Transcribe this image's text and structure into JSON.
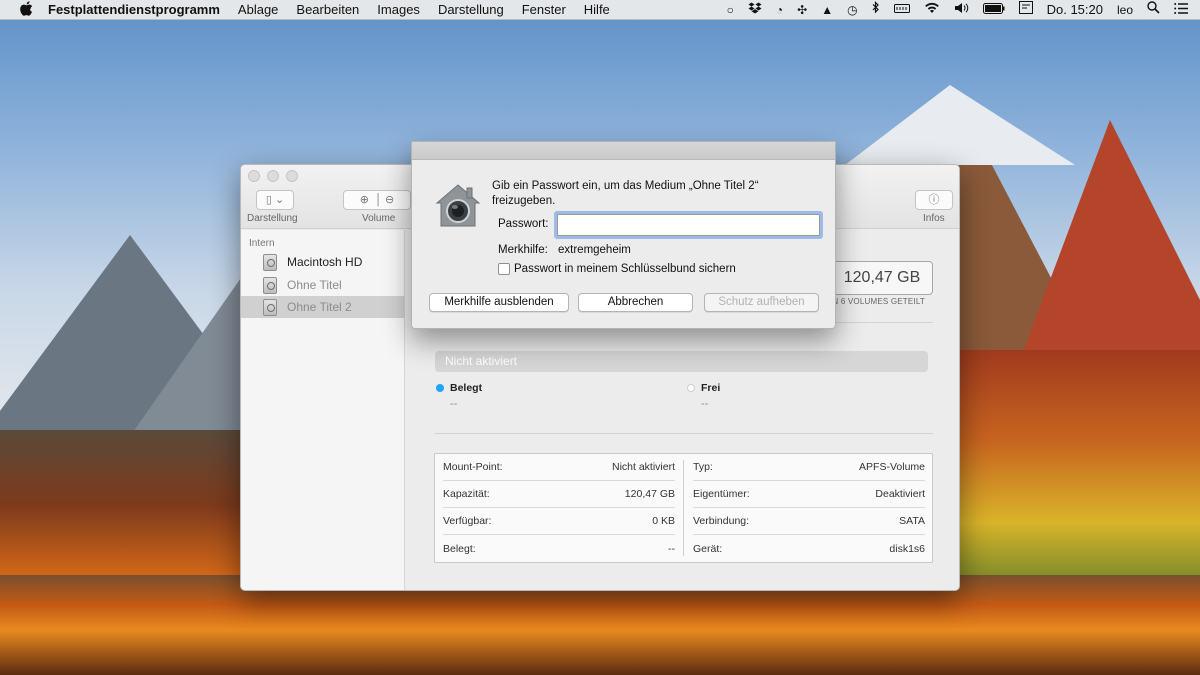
{
  "menubar": {
    "apple_icon": "apple-icon",
    "app_name": "Festplattendienstprogramm",
    "menus": [
      "Ablage",
      "Bearbeiten",
      "Images",
      "Darstellung",
      "Fenster",
      "Hilfe"
    ],
    "status_icons": [
      "circle-icon",
      "dropbox-icon",
      "time-machine-icon",
      "pinwheel-icon",
      "upload-triangle-icon",
      "history-icon",
      "bluetooth-icon",
      "memory-icon",
      "wifi-icon",
      "volume-icon",
      "battery-icon",
      "display-icon"
    ],
    "battery_text": "",
    "clock": "Do. 15:20",
    "user": "leo"
  },
  "window": {
    "toolbar": {
      "view_label": "Darstellung",
      "volume_label": "Volume",
      "info_label": "Infos"
    },
    "sidebar": {
      "section_header": "Intern",
      "items": [
        {
          "label": "Macintosh HD"
        },
        {
          "label": "Ohne Titel"
        },
        {
          "label": "Ohne Titel 2"
        }
      ]
    },
    "summary": {
      "capacity": "120,47 GB",
      "shared_note": "ON 6 VOLUMES GETEILT"
    },
    "usage": {
      "bar_text": "Nicht aktiviert",
      "used_label": "Belegt",
      "used_value": "--",
      "used_color": "#1fa6f2",
      "free_label": "Frei",
      "free_value": "--",
      "free_color": "#ffffff"
    },
    "info": {
      "left": [
        {
          "key": "Mount-Point:",
          "value": "Nicht aktiviert"
        },
        {
          "key": "Kapazität:",
          "value": "120,47 GB"
        },
        {
          "key": "Verfügbar:",
          "value": "0 KB"
        },
        {
          "key": "Belegt:",
          "value": "--"
        }
      ],
      "right": [
        {
          "key": "Typ:",
          "value": "APFS-Volume"
        },
        {
          "key": "Eigentümer:",
          "value": "Deaktiviert"
        },
        {
          "key": "Verbindung:",
          "value": "SATA"
        },
        {
          "key": "Gerät:",
          "value": "disk1s6"
        }
      ]
    }
  },
  "dialog": {
    "message": "Gib ein Passwort ein, um das Medium „Ohne Titel 2“ freizugeben.",
    "password_label": "Passwort:",
    "password_value": "",
    "hint_label": "Merkhilfe:",
    "hint_value": "extremgeheim",
    "keychain_label": "Passwort in meinem Schlüsselbund sichern",
    "keychain_checked": false,
    "btn_hide_hint": "Merkhilfe ausblenden",
    "btn_cancel": "Abbrechen",
    "btn_unlock": "Schutz aufheben"
  }
}
